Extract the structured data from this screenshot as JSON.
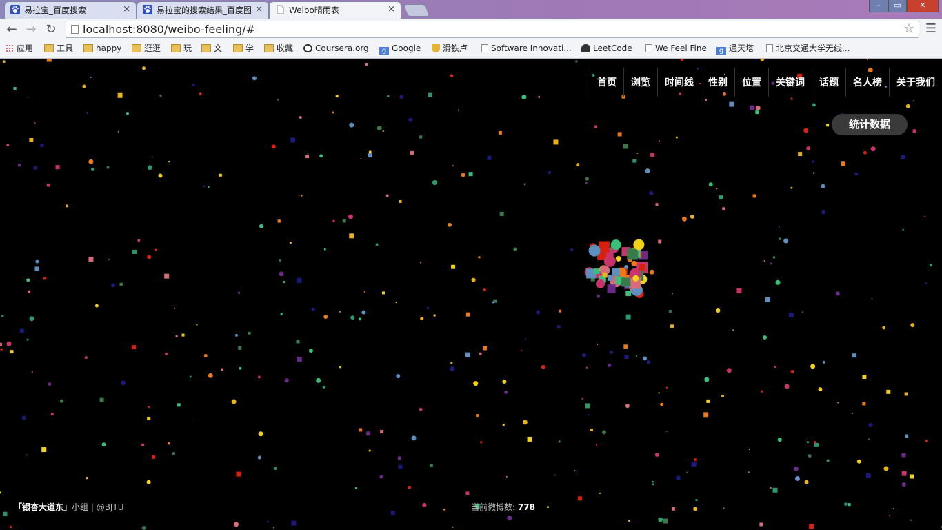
{
  "browser": {
    "tabs": [
      {
        "title": "易拉宝_百度搜索",
        "favicon": "baidu-paw-icon",
        "active": false
      },
      {
        "title": "易拉宝的搜索结果_百度图",
        "favicon": "baidu-paw-icon",
        "active": false
      },
      {
        "title": "Weibo晴雨表",
        "favicon": "page-icon",
        "active": true
      }
    ],
    "close_glyph": "×",
    "window_buttons": {
      "minimize": "–",
      "maximize": "▭",
      "close": "✕"
    },
    "url": "localhost:8080/weibo-feeling/#",
    "bookmarks": [
      {
        "label": "应用",
        "icon": "apps-grid-icon"
      },
      {
        "label": "工具",
        "icon": "folder-icon"
      },
      {
        "label": "happy",
        "icon": "folder-icon"
      },
      {
        "label": "逛逛",
        "icon": "folder-icon"
      },
      {
        "label": "玩",
        "icon": "folder-icon"
      },
      {
        "label": "文",
        "icon": "folder-icon"
      },
      {
        "label": "学",
        "icon": "folder-icon"
      },
      {
        "label": "收藏",
        "icon": "folder-icon"
      },
      {
        "label": "Coursera.org",
        "icon": "coursera-icon"
      },
      {
        "label": "Google",
        "icon": "google-icon"
      },
      {
        "label": "滑铁卢",
        "icon": "shield-icon"
      },
      {
        "label": "Software Innovati...",
        "icon": "page-icon"
      },
      {
        "label": "LeetCode",
        "icon": "person-icon"
      },
      {
        "label": "We Feel Fine",
        "icon": "page-icon"
      },
      {
        "label": "通天塔",
        "icon": "google-icon"
      },
      {
        "label": "北京交通大学无线...",
        "icon": "page-icon"
      }
    ]
  },
  "site": {
    "nav": [
      "首页",
      "浏览",
      "时间线",
      "性别",
      "位置",
      "关键词",
      "话题",
      "名人榜",
      "关于我们"
    ],
    "stats_button": "统计数据",
    "footer_group": "「银杏大道东」",
    "footer_suffix": "小组 | @BJTU",
    "counter_label": "当前微博数:",
    "counter_value": "778"
  },
  "palette": [
    "#e87a1a",
    "#c8336c",
    "#e8b21c",
    "#3bbf7a",
    "#5f8fbf",
    "#d8200e",
    "#3a7a4a",
    "#6b2a8a",
    "#f2d21a",
    "#d86a7a",
    "#1a1a7a",
    "#2a9a6a"
  ]
}
